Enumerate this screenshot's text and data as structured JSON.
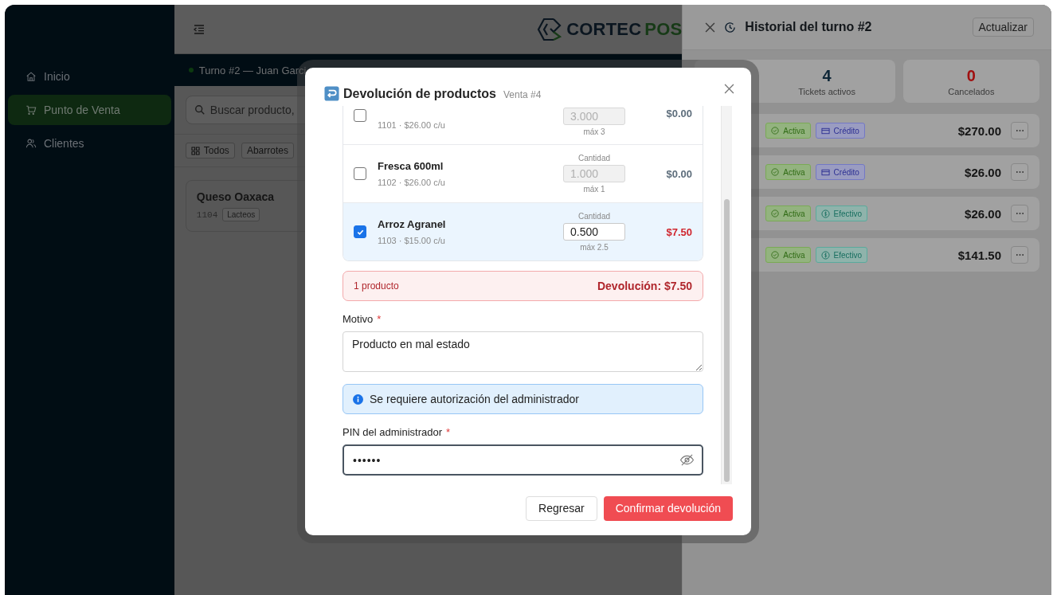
{
  "sidebar": {
    "items": [
      {
        "label": "Inicio",
        "selected": false
      },
      {
        "label": "Punto de Venta",
        "selected": true
      },
      {
        "label": "Clientes",
        "selected": false
      }
    ]
  },
  "header": {
    "logo": {
      "word_1": "CORTEC",
      "word_2": "POS"
    }
  },
  "shift_bar": {
    "text": "Turno #2 — Juan Garci"
  },
  "search": {
    "placeholder": "Buscar producto,"
  },
  "categories": [
    {
      "label": "Todos",
      "kind": "all"
    },
    {
      "label": "Abarrotes",
      "kind": "category"
    }
  ],
  "products": [
    {
      "name": "Queso Oaxaca",
      "code": "1104",
      "category": "Lacteos"
    }
  ],
  "history": {
    "title": "Historial del turno #2",
    "refresh": "Actualizar",
    "stats": [
      {
        "value": "4",
        "label": "Tickets activos",
        "kind": "active"
      },
      {
        "value": "0",
        "label": "Cancelados",
        "kind": "cancelled"
      }
    ],
    "tickets": [
      {
        "status": "Activa",
        "payment": "Crédito",
        "kind": "credit",
        "total": "$270.00"
      },
      {
        "status": "Activa",
        "payment": "Crédito",
        "kind": "credit",
        "total": "$26.00"
      },
      {
        "status": "Activa",
        "payment": "Efectivo",
        "kind": "cash",
        "total": "$26.00"
      },
      {
        "status": "Activa",
        "payment": "Efectivo",
        "kind": "cash",
        "total": "$141.50"
      }
    ]
  },
  "modal": {
    "title": "Devolución de productos",
    "subtitle": "Venta #4",
    "items": [
      {
        "checked": false,
        "meta": "1101 · $26.00 c/u",
        "quantity": "3.000",
        "max": "máx 3",
        "amount": "$0.00"
      },
      {
        "checked": false,
        "name": "Fresca 600ml",
        "meta": "1102 · $26.00 c/u",
        "quantity_label": "Cantidad",
        "quantity": "1.000",
        "max": "máx 1",
        "amount": "$0.00"
      },
      {
        "checked": true,
        "name": "Arroz Agranel",
        "meta": "1103 · $15.00 c/u",
        "quantity_label": "Cantidad",
        "quantity": "0.500",
        "max": "máx 2.5",
        "amount": "$7.50"
      }
    ],
    "summary": {
      "count": "1 producto",
      "total": "Devolución: $7.50"
    },
    "reason": {
      "label": "Motivo",
      "mark": "*",
      "value": "Producto en mal estado"
    },
    "notice": "Se requiere autorización del administrador",
    "pin": {
      "label": "PIN del administrador",
      "mark": "*",
      "value": "••••••"
    },
    "buttons": {
      "back": "Regresar",
      "confirm": "Confirmar devolución"
    }
  }
}
